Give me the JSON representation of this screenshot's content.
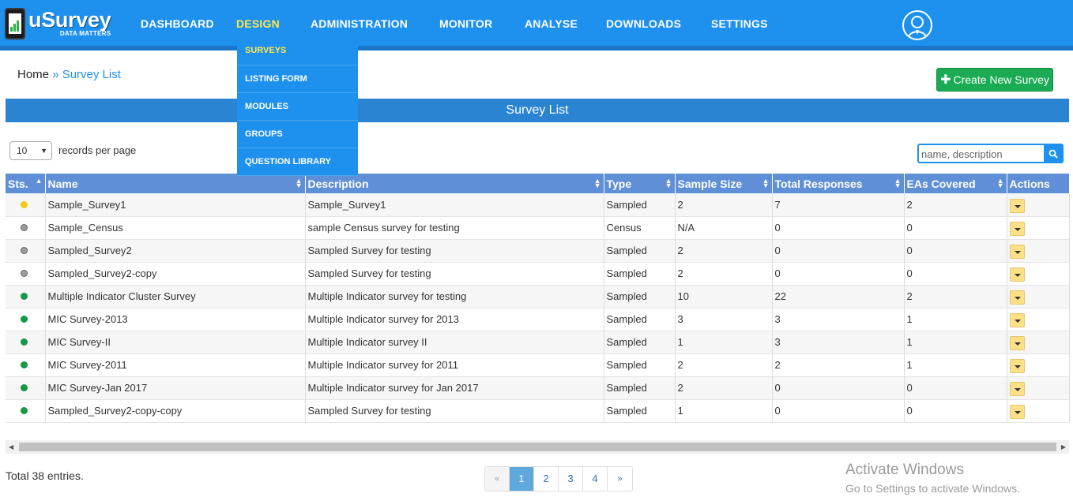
{
  "app": {
    "logo_title": "uSurvey",
    "logo_tagline": "DATA MATTERS"
  },
  "nav": {
    "items": [
      "DASHBOARD",
      "DESIGN",
      "ADMINISTRATION",
      "MONITOR",
      "ANALYSE",
      "DOWNLOADS",
      "SETTINGS"
    ],
    "active": "DESIGN"
  },
  "dropdown": {
    "items": [
      "SURVEYS",
      "LISTING FORM",
      "MODULES",
      "GROUPS",
      "QUESTION LIBRARY"
    ],
    "active": "SURVEYS"
  },
  "breadcrumb": {
    "home": "Home",
    "separator": "»",
    "current": "Survey List"
  },
  "create_button": {
    "icon": "plus-icon",
    "label": "Create New Survey"
  },
  "list_title": "Survey List",
  "records": {
    "value": "10",
    "label": "records per page"
  },
  "search": {
    "placeholder": "name, description",
    "icon": "search-icon"
  },
  "table": {
    "columns": [
      "Sts.",
      "Name",
      "Description",
      "Type",
      "Sample Size",
      "Total Responses",
      "EAs Covered",
      "Actions"
    ],
    "rows": [
      {
        "status": "yellow",
        "name": "Sample_Survey1",
        "description": "Sample_Survey1",
        "type": "Sampled",
        "sample_size": "2",
        "total_responses": "7",
        "eas_covered": "2"
      },
      {
        "status": "gray",
        "name": "Sample_Census",
        "description": "sample Census survey for testing",
        "type": "Census",
        "sample_size": "N/A",
        "total_responses": "0",
        "eas_covered": "0"
      },
      {
        "status": "gray",
        "name": "Sampled_Survey2",
        "description": "Sampled Survey for testing",
        "type": "Sampled",
        "sample_size": "2",
        "total_responses": "0",
        "eas_covered": "0"
      },
      {
        "status": "gray",
        "name": "Sampled_Survey2-copy",
        "description": "Sampled Survey for testing",
        "type": "Sampled",
        "sample_size": "2",
        "total_responses": "0",
        "eas_covered": "0"
      },
      {
        "status": "green",
        "name": "Multiple Indicator Cluster Survey",
        "description": "Multiple Indicator survey for testing",
        "type": "Sampled",
        "sample_size": "10",
        "total_responses": "22",
        "eas_covered": "2"
      },
      {
        "status": "green",
        "name": "MIC Survey-2013",
        "description": "Multiple Indicator survey for 2013",
        "type": "Sampled",
        "sample_size": "3",
        "total_responses": "3",
        "eas_covered": "1"
      },
      {
        "status": "green",
        "name": "MIC Survey-II",
        "description": "Multiple Indicator survey II",
        "type": "Sampled",
        "sample_size": "1",
        "total_responses": "3",
        "eas_covered": "1"
      },
      {
        "status": "green",
        "name": "MIC Survey-2011",
        "description": "Multiple Indicator survey for 2011",
        "type": "Sampled",
        "sample_size": "2",
        "total_responses": "2",
        "eas_covered": "1"
      },
      {
        "status": "green",
        "name": "MIC Survey-Jan 2017",
        "description": "Multiple Indicator survey for Jan 2017",
        "type": "Sampled",
        "sample_size": "2",
        "total_responses": "0",
        "eas_covered": "0"
      },
      {
        "status": "green",
        "name": "Sampled_Survey2-copy-copy",
        "description": "Sampled Survey for testing",
        "type": "Sampled",
        "sample_size": "1",
        "total_responses": "0",
        "eas_covered": "0"
      }
    ]
  },
  "footer": {
    "total": "Total 38 entries."
  },
  "pagination": {
    "prev": "«",
    "pages": [
      "1",
      "2",
      "3",
      "4"
    ],
    "active": "1",
    "next": "»"
  },
  "watermark": {
    "line1": "Activate Windows",
    "line2": "Go to Settings to activate Windows."
  },
  "colors": {
    "nav_bg": "#1e90ee",
    "active_nav": "#ffe94a",
    "create_button": "#1aab54",
    "header_bar": "#2a84d1",
    "table_header": "#5f8fd6",
    "status_yellow": "#f7c815",
    "status_gray": "#9c9c9c",
    "status_green": "#159842"
  }
}
